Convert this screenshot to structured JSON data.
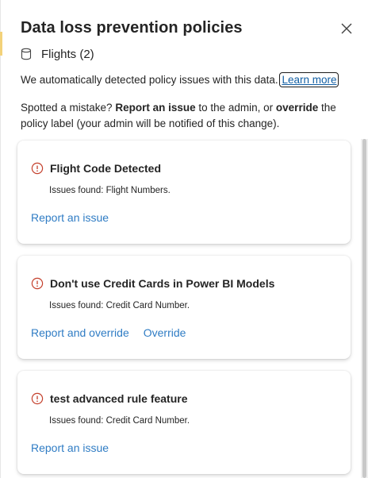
{
  "panel": {
    "title": "Data loss prevention policies",
    "close_icon": "close-icon",
    "dataset": {
      "icon": "database-icon",
      "name": "Flights (2)"
    },
    "description": "We automatically detected policy issues with this data.",
    "learn_more": "Learn more",
    "mistake": {
      "prefix": "Spotted a mistake? ",
      "report_bold": "Report an issue",
      "middle": " to the admin, or ",
      "override_bold": "override",
      "suffix": " the policy label (your admin will be notified of this change)."
    }
  },
  "policies": [
    {
      "title": "Flight Code Detected",
      "issues": "Issues found: Flight Numbers.",
      "actions": [
        "Report an issue"
      ]
    },
    {
      "title": "Don't use Credit Cards in Power BI Models",
      "issues": "Issues found: Credit Card Number.",
      "actions": [
        "Report and override",
        "Override"
      ]
    },
    {
      "title": "test advanced rule feature",
      "issues": "Issues found: Credit Card Number.",
      "actions": [
        "Report an issue"
      ]
    }
  ],
  "colors": {
    "warning": "#c4402c",
    "link": "#2f7cc4",
    "learn_more": "#115ea3"
  }
}
